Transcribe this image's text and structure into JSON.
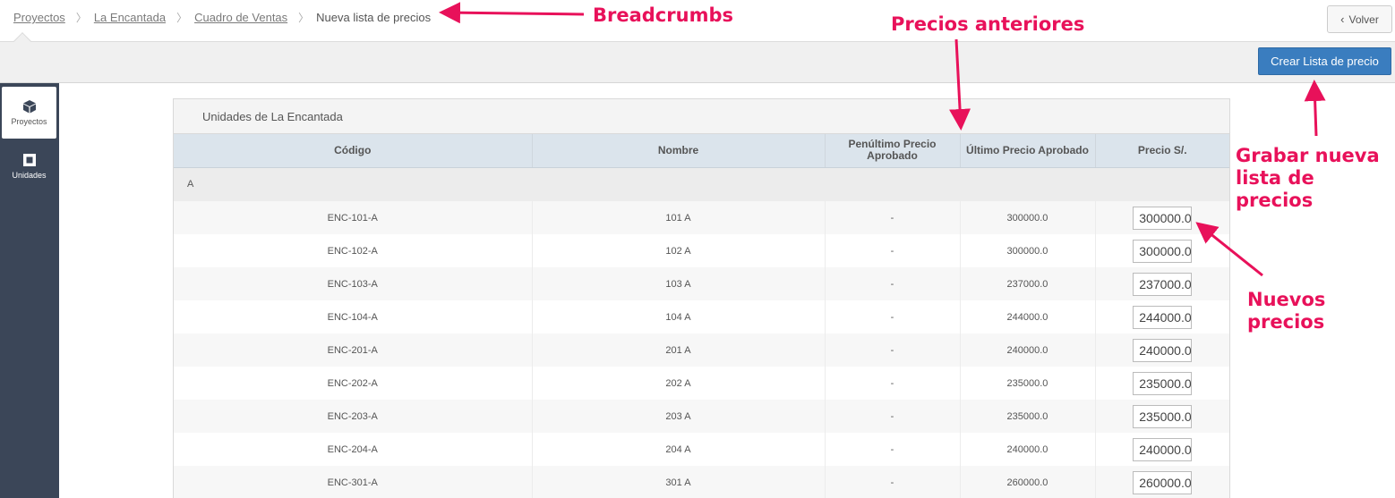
{
  "breadcrumb": {
    "items": [
      "Proyectos",
      "La Encantada",
      "Cuadro de Ventas"
    ],
    "current": "Nueva lista de precios"
  },
  "header": {
    "back_label": "Volver"
  },
  "toolbar": {
    "create_label": "Crear Lista de precio"
  },
  "sidebar": {
    "items": [
      {
        "label": "Proyectos",
        "icon": "cube-icon",
        "active": true
      },
      {
        "label": "Unidades",
        "icon": "square-icon",
        "active": false
      }
    ]
  },
  "panel": {
    "title": "Unidades de La Encantada",
    "columns": [
      "Código",
      "Nombre",
      "Penúltimo Precio Aprobado",
      "Último Precio Aprobado",
      "Precio S/."
    ],
    "group_label": "A",
    "rows": [
      {
        "codigo": "ENC-101-A",
        "nombre": "101 A",
        "penultimo": "-",
        "ultimo": "300000.0",
        "precio": "300000.0"
      },
      {
        "codigo": "ENC-102-A",
        "nombre": "102 A",
        "penultimo": "-",
        "ultimo": "300000.0",
        "precio": "300000.0"
      },
      {
        "codigo": "ENC-103-A",
        "nombre": "103 A",
        "penultimo": "-",
        "ultimo": "237000.0",
        "precio": "237000.0"
      },
      {
        "codigo": "ENC-104-A",
        "nombre": "104 A",
        "penultimo": "-",
        "ultimo": "244000.0",
        "precio": "244000.0"
      },
      {
        "codigo": "ENC-201-A",
        "nombre": "201 A",
        "penultimo": "-",
        "ultimo": "240000.0",
        "precio": "240000.0"
      },
      {
        "codigo": "ENC-202-A",
        "nombre": "202 A",
        "penultimo": "-",
        "ultimo": "235000.0",
        "precio": "235000.0"
      },
      {
        "codigo": "ENC-203-A",
        "nombre": "203 A",
        "penultimo": "-",
        "ultimo": "235000.0",
        "precio": "235000.0"
      },
      {
        "codigo": "ENC-204-A",
        "nombre": "204 A",
        "penultimo": "-",
        "ultimo": "240000.0",
        "precio": "240000.0"
      },
      {
        "codigo": "ENC-301-A",
        "nombre": "301 A",
        "penultimo": "-",
        "ultimo": "260000.0",
        "precio": "260000.0"
      }
    ]
  },
  "annotations": {
    "breadcrumbs": "Breadcrumbs",
    "precios_anteriores": "Precios anteriores",
    "grabar_line1": "Grabar nueva",
    "grabar_line2": "lista de precios",
    "nuevos_line1": "Nuevos",
    "nuevos_line2": "precios",
    "color": "#e8115a"
  },
  "colors": {
    "sidebar": "#3b4658",
    "primary_button": "#3a7dbf",
    "table_header": "#dbe4ec"
  }
}
